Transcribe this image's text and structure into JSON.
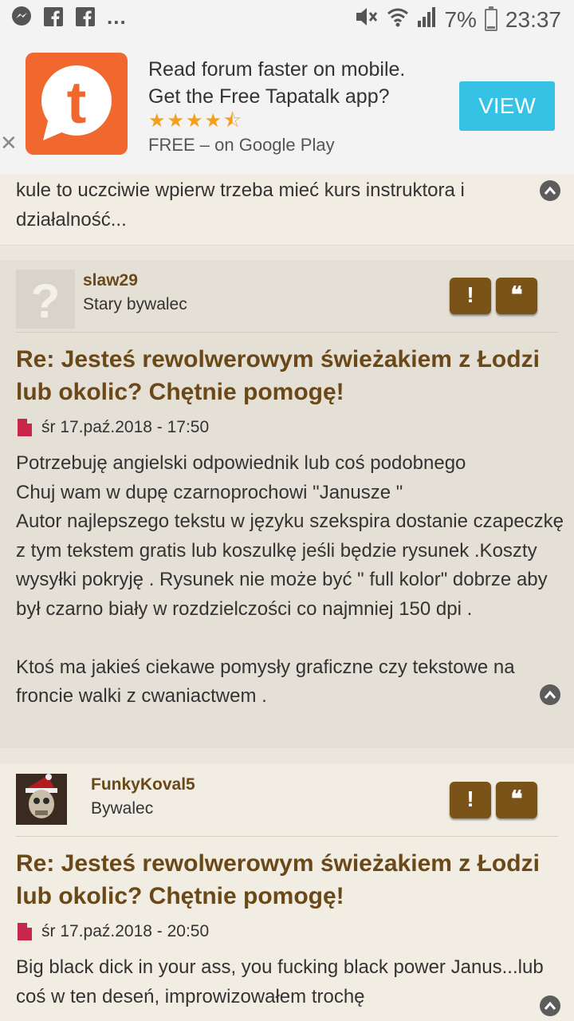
{
  "status_bar": {
    "left_icons": [
      "messenger-icon",
      "facebook-icon",
      "facebook-icon",
      "more-dots-icon"
    ],
    "more": "...",
    "battery": "7%",
    "time": "23:37",
    "right_icons": [
      "mute-icon",
      "wifi-icon",
      "signal-icon",
      "battery-icon"
    ]
  },
  "banner": {
    "line1": "Read forum faster on mobile.",
    "line2": "Get the Free Tapatalk app?",
    "stars": "★★★★⯪",
    "rating": 4.5,
    "store": "FREE – on Google Play",
    "view_label": "VIEW",
    "close_label": "✕",
    "logo_letter": "t",
    "accent": "#f0682e",
    "button_color": "#35c2e5"
  },
  "prev_post": {
    "body": "kule to uczciwie wpierw trzeba mieć kurs instruktora i działalność..."
  },
  "posts": [
    {
      "username": "slaw29",
      "rank": "Stary bywalec",
      "report_label": "!",
      "quote_label": "❝",
      "title": "Re: Jesteś rewolwerowym świeżakiem z Łodzi lub okolic? Chętnie pomogę!",
      "date": "śr 17.paź.2018 - 17:50",
      "body": "Potrzebuję angielski odpowiednik lub coś podobnego\nChuj wam w dupę czarnoprochowi \"Janusze \"\nAutor najlepszego tekstu w języku szekspira dostanie czapeczkę z tym tekstem gratis lub koszulkę jeśli będzie rysunek .Koszty wysyłki pokryję . Rysunek nie może być \" full kolor\" dobrze aby był czarno biały w rozdzielczości co najmniej 150 dpi .\n\nKtoś ma jakieś ciekawe pomysły graficzne czy tekstowe na froncie walki z cwaniactwem ."
    },
    {
      "username": "FunkyKoval5",
      "rank": "Bywalec",
      "report_label": "!",
      "quote_label": "❝",
      "title": "Re: Jesteś rewolwerowym świeżakiem z Łodzi lub okolic? Chętnie pomogę!",
      "date": "śr 17.paź.2018 - 20:50",
      "body": "Big black dick in your ass, you fucking black power Janus...lub coś w ten deseń, improwizowałem trochę"
    }
  ],
  "colors": {
    "title": "#6a4818",
    "button": "#7a5318",
    "post_icon": "#c8264a"
  }
}
